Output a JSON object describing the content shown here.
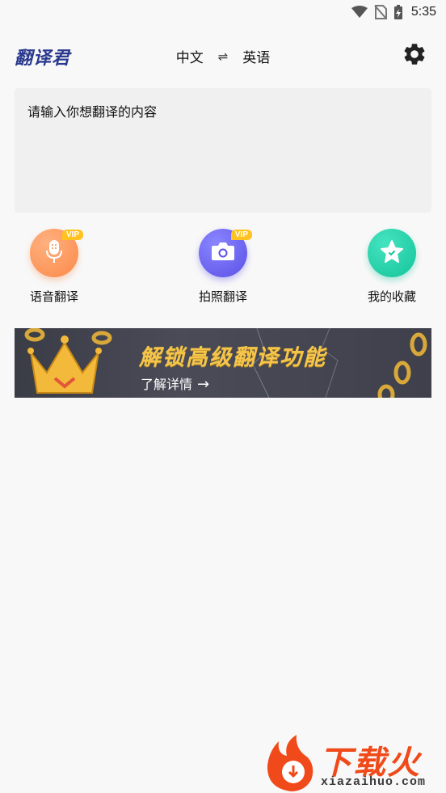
{
  "status_bar": {
    "time": "5:35",
    "icons": [
      "wifi-icon",
      "no-sim-icon",
      "battery-charging-icon"
    ]
  },
  "header": {
    "app_name": "翻译君",
    "source_lang": "中文",
    "swap_symbol": "⇌",
    "target_lang": "英语",
    "settings_icon": "gear-icon"
  },
  "input": {
    "placeholder": "请输入你想翻译的内容",
    "value": ""
  },
  "features": [
    {
      "label": "语音翻译",
      "icon": "microphone-icon",
      "vip": "VIP",
      "color": "#fb8a4a"
    },
    {
      "label": "拍照翻译",
      "icon": "camera-icon",
      "vip": "VIP",
      "color": "#5a50e6"
    },
    {
      "label": "我的收藏",
      "icon": "star-icon",
      "color": "#14c49a"
    }
  ],
  "banner": {
    "title": "解锁高级翻译功能",
    "link_text": "了解详情",
    "arrow": "→",
    "accent": "#f5c54b"
  },
  "watermark": {
    "text": "下载火",
    "sub": "xiazaihuo.com"
  }
}
